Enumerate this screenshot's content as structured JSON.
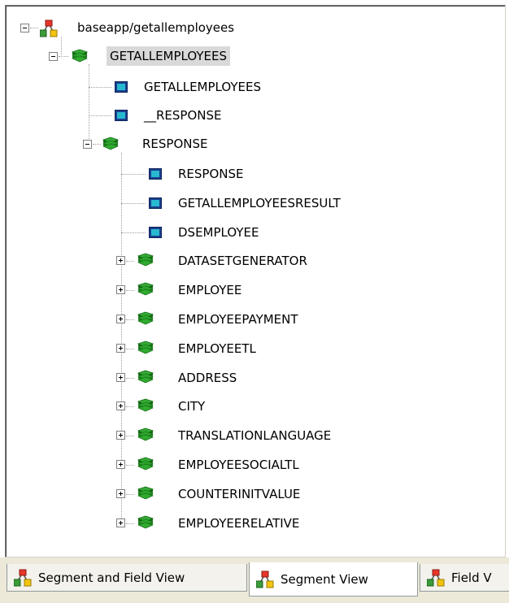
{
  "tree": {
    "root": {
      "label": "baseapp/getallemployees",
      "icon": "hierarchy-icon"
    },
    "getall": {
      "label": "GETALLEMPLOYEES",
      "icon": "segment-stack-icon"
    },
    "field_getall": {
      "label": "GETALLEMPLOYEES",
      "icon": "field-icon"
    },
    "field_response_us": {
      "label": "__RESPONSE",
      "icon": "field-icon"
    },
    "response": {
      "label": "RESPONSE",
      "icon": "segment-stack-icon"
    },
    "response_fields": [
      "RESPONSE",
      "GETALLEMPLOYEESRESULT",
      "DSEMPLOYEE"
    ],
    "response_segments": [
      "DATASETGENERATOR",
      "EMPLOYEE",
      "EMPLOYEEPAYMENT",
      "EMPLOYEETL",
      "ADDRESS",
      "CITY",
      "TRANSLATIONLANGUAGE",
      "EMPLOYEESOCIALTL",
      "COUNTERINITVALUE",
      "EMPLOYEERELATIVE"
    ]
  },
  "tabs": [
    {
      "label": "Segment and Field View",
      "active": false
    },
    {
      "label": "Segment View",
      "active": true
    },
    {
      "label": "Field V",
      "active": false
    }
  ],
  "colors": {
    "segment_green": "#1e8c1e",
    "field_cyan": "#27b9cf",
    "selected_bg": "#d9d9d9"
  }
}
